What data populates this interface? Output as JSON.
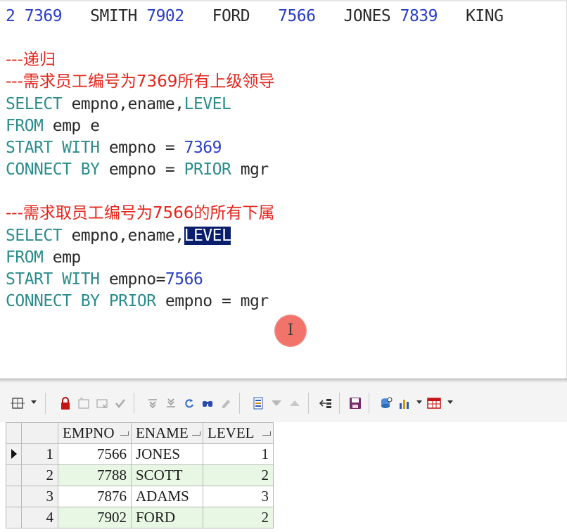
{
  "editor": {
    "lines": [
      {
        "segments": [
          {
            "t": "2 7369",
            "c": "num"
          },
          {
            "t": "   SMITH ",
            "c": "txt"
          },
          {
            "t": "7902",
            "c": "num"
          },
          {
            "t": "   FORD   ",
            "c": "txt"
          },
          {
            "t": "7566",
            "c": "num"
          },
          {
            "t": "   JONES ",
            "c": "txt"
          },
          {
            "t": "7839",
            "c": "num"
          },
          {
            "t": "   KING",
            "c": "txt"
          }
        ]
      },
      {
        "segments": [
          {
            "t": "",
            "c": "txt"
          }
        ]
      },
      {
        "segments": [
          {
            "t": "---递归",
            "c": "cmt"
          }
        ]
      },
      {
        "segments": [
          {
            "t": "---需求员工编号为7369所有上级领导",
            "c": "cmt"
          }
        ]
      },
      {
        "segments": [
          {
            "t": "SELECT",
            "c": "kw"
          },
          {
            "t": " empno,ename,",
            "c": "txt"
          },
          {
            "t": "LEVEL",
            "c": "kw"
          }
        ]
      },
      {
        "segments": [
          {
            "t": "FROM",
            "c": "kw"
          },
          {
            "t": " emp e",
            "c": "txt"
          }
        ]
      },
      {
        "segments": [
          {
            "t": "START WITH",
            "c": "kw"
          },
          {
            "t": " empno = ",
            "c": "txt"
          },
          {
            "t": "7369",
            "c": "num"
          }
        ]
      },
      {
        "segments": [
          {
            "t": "CONNECT BY",
            "c": "kw"
          },
          {
            "t": " empno = ",
            "c": "txt"
          },
          {
            "t": "PRIOR",
            "c": "kw"
          },
          {
            "t": " mgr",
            "c": "txt"
          }
        ]
      },
      {
        "segments": [
          {
            "t": "",
            "c": "txt"
          }
        ]
      },
      {
        "segments": [
          {
            "t": "---需求取员工编号为7566的所有下属",
            "c": "cmt"
          }
        ]
      },
      {
        "segments": [
          {
            "t": "SELECT",
            "c": "kw"
          },
          {
            "t": " empno,ename,",
            "c": "txt"
          },
          {
            "t": "LEVEL",
            "c": "sel"
          }
        ]
      },
      {
        "segments": [
          {
            "t": "FROM",
            "c": "kw"
          },
          {
            "t": " emp",
            "c": "txt"
          }
        ]
      },
      {
        "segments": [
          {
            "t": "START WITH",
            "c": "kw"
          },
          {
            "t": " empno=",
            "c": "txt"
          },
          {
            "t": "7566",
            "c": "num"
          }
        ]
      },
      {
        "segments": [
          {
            "t": "CONNECT BY PRIOR",
            "c": "kw"
          },
          {
            "t": " empno = mgr",
            "c": "txt"
          }
        ]
      }
    ]
  },
  "colors": {
    "keyword": "#2c8c8c",
    "number": "#2a3fc2",
    "comment": "#e3261b",
    "selection": "#0a1e6e",
    "alt_row": "#e8f7e4"
  },
  "toolbar": {
    "icons": [
      "grid-options-icon",
      "lock-icon",
      "insert-record-icon",
      "delete-record-icon",
      "post-changes-icon",
      "first-record-icon",
      "last-record-icon",
      "refresh-icon",
      "find-icon",
      "clear-icon",
      "single-record-view-icon",
      "sort-down-icon",
      "sort-up-icon",
      "export-icon",
      "save-icon",
      "query-by-example-icon",
      "chart-icon",
      "table-view-icon"
    ]
  },
  "results": {
    "columns": [
      "EMPNO",
      "ENAME",
      "LEVEL"
    ],
    "rows": [
      {
        "n": "1",
        "empno": "7566",
        "ename": "JONES",
        "level": "1",
        "current": true
      },
      {
        "n": "2",
        "empno": "7788",
        "ename": "SCOTT",
        "level": "2",
        "current": false
      },
      {
        "n": "3",
        "empno": "7876",
        "ename": "ADAMS",
        "level": "3",
        "current": false
      },
      {
        "n": "4",
        "empno": "7902",
        "ename": "FORD",
        "level": "2",
        "current": false
      }
    ]
  }
}
